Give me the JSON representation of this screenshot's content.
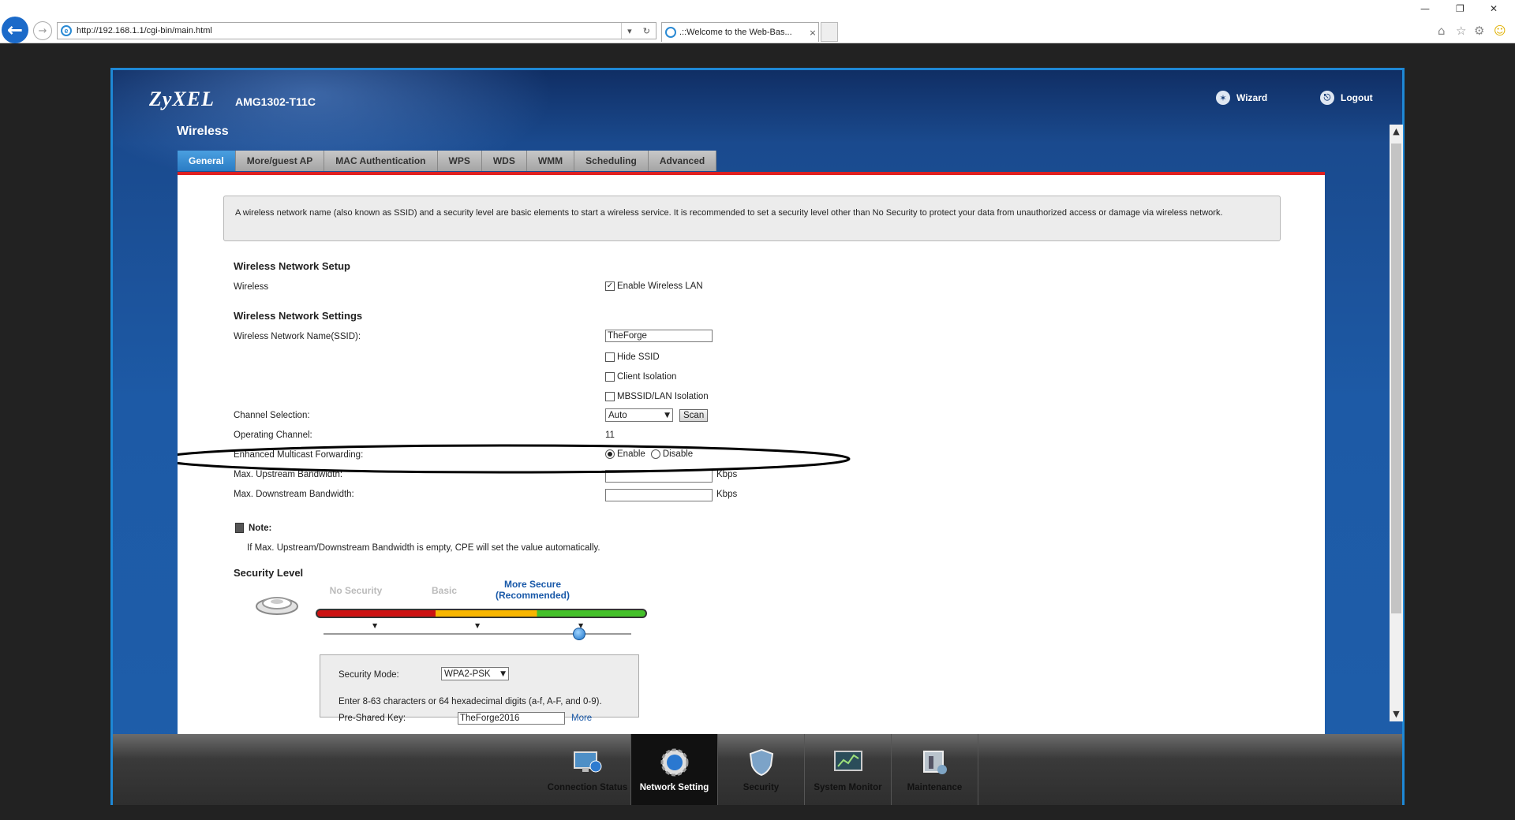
{
  "browser": {
    "url": "http://192.168.1.1/cgi-bin/main.html",
    "tab_title": ".::Welcome to the Web-Bas...",
    "tab_close": "×",
    "address_controls": [
      "▾",
      "↻"
    ],
    "window_controls": [
      "—",
      "❐",
      "✕"
    ],
    "toolbar_icons": [
      "home-icon",
      "favorites-star-icon",
      "settings-gear-icon",
      "smiley-feedback-icon"
    ]
  },
  "router": {
    "brand": "ZyXEL",
    "model": "AMG1302-T11C",
    "page_title": "Wireless",
    "wizard_label": "Wizard",
    "logout_label": "Logout",
    "tabs": [
      "General",
      "More/guest AP",
      "MAC Authentication",
      "WPS",
      "WDS",
      "WMM",
      "Scheduling",
      "Advanced"
    ],
    "active_tab": "General"
  },
  "info_text": "A wireless network name (also known as SSID) and a security level are basic elements to start a wireless service. It is recommended to set a security level other than No Security to protect your data from unauthorized access or damage via wireless network.",
  "setup": {
    "heading": "Wireless Network Setup",
    "wireless_label": "Wireless",
    "enable_label": "Enable Wireless LAN",
    "enable_checked": true
  },
  "settings": {
    "heading": "Wireless Network Settings",
    "ssid_label": "Wireless Network Name(SSID):",
    "ssid_value": "TheForge",
    "hide_ssid": "Hide SSID",
    "client_isolation": "Client Isolation",
    "mbssid_isolation": "MBSSID/LAN Isolation",
    "channel_label": "Channel Selection:",
    "channel_value": "Auto",
    "scan_label": "Scan",
    "op_channel_label": "Operating Channel:",
    "op_channel_value": "11",
    "emf_label": "Enhanced Multicast Forwarding:",
    "emf_enable": "Enable",
    "emf_disable": "Disable",
    "emf_selected": "Enable",
    "up_label": "Max. Upstream Bandwidth:",
    "down_label": "Max. Downstream Bandwidth:",
    "unit": "Kbps"
  },
  "note": {
    "heading": "Note:",
    "text": "If Max. Upstream/Downstream Bandwidth is empty, CPE will set the value automatically."
  },
  "security": {
    "heading": "Security Level",
    "levels": [
      "No Security",
      "Basic",
      "More Secure"
    ],
    "recommended": "(Recommended)",
    "selected_level_index": 2,
    "mode_label": "Security Mode:",
    "mode_value": "WPA2-PSK",
    "hint": "Enter 8-63 characters or 64 hexadecimal digits (a-f, A-F, and 0-9).",
    "psk_label": "Pre-Shared Key:",
    "psk_value": "TheForge2016",
    "more_link": "More"
  },
  "bottom_nav": {
    "items": [
      "Connection Status",
      "Network Setting",
      "Security",
      "System Monitor",
      "Maintenance"
    ],
    "active": "Network Setting"
  },
  "colors": {
    "brand_blue": "#1d5aa6",
    "accent_red": "#e02020",
    "active_tab": "#2b7cc4"
  }
}
